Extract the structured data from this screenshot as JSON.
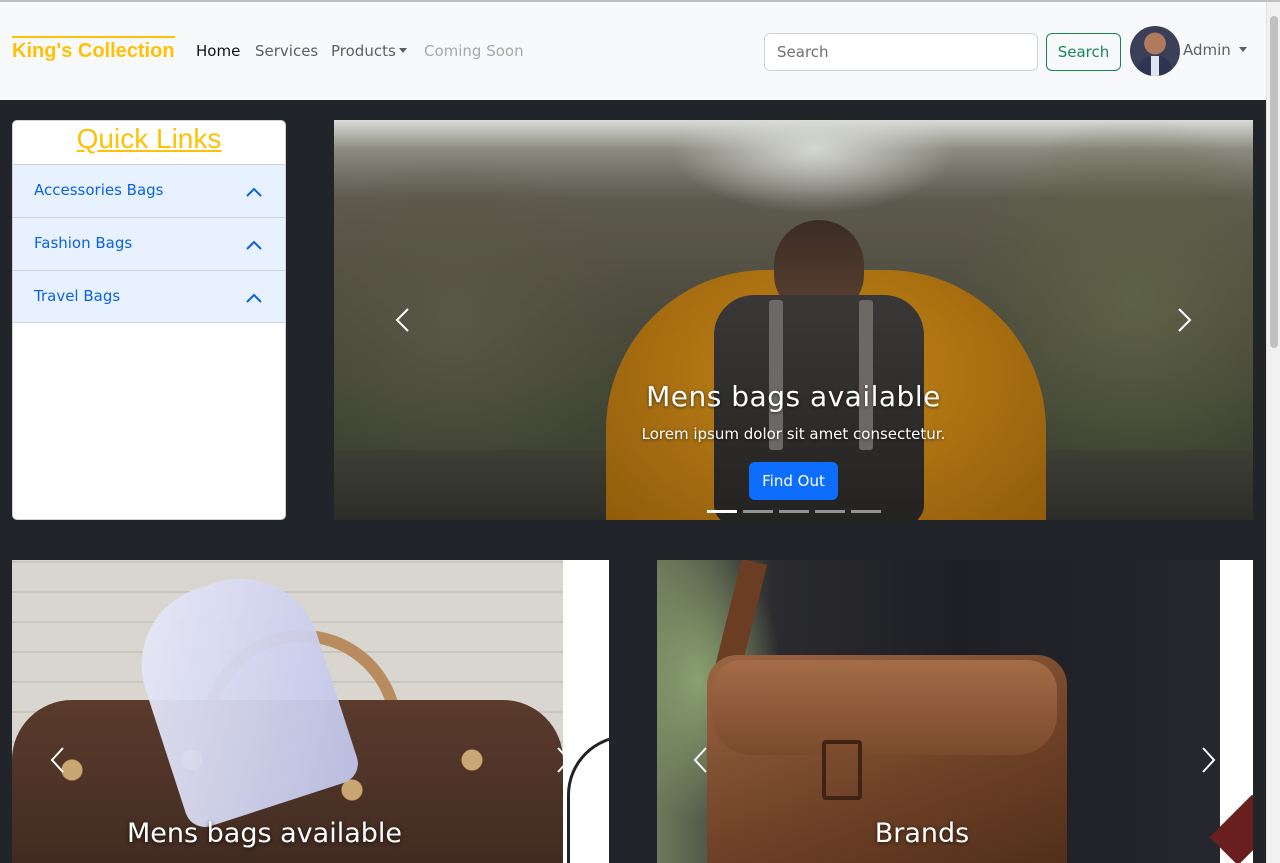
{
  "navbar": {
    "brand": "King's Collection",
    "links": {
      "home": "Home",
      "services": "Services",
      "products": "Products",
      "coming_soon": "Coming Soon"
    },
    "search": {
      "placeholder": "Search",
      "value": "",
      "button_label": "Search"
    },
    "user": {
      "name": "Admin"
    }
  },
  "sidebar": {
    "title": "Quick Links",
    "items": [
      {
        "label": "Accessories Bags",
        "icon": "chevron-up-icon"
      },
      {
        "label": "Fashion Bags",
        "icon": "chevron-up-icon"
      },
      {
        "label": "Travel Bags",
        "icon": "chevron-up-icon"
      }
    ]
  },
  "hero_carousel": {
    "slides_count": 5,
    "active_slide": 1,
    "heading": "Mens bags available",
    "text": "Lorem ipsum dolor sit amet consectetur.",
    "button_label": "Find Out"
  },
  "cards": [
    {
      "caption": "Mens bags available"
    },
    {
      "caption": "Brands"
    }
  ],
  "colors": {
    "brand": "#ffc107",
    "primary": "#0d6efd",
    "success": "#198754",
    "accordion_bg": "#e7f1ff",
    "accordion_text": "#0c63e4",
    "page_bg": "#212529",
    "navbar_bg": "#f8f9fa"
  }
}
